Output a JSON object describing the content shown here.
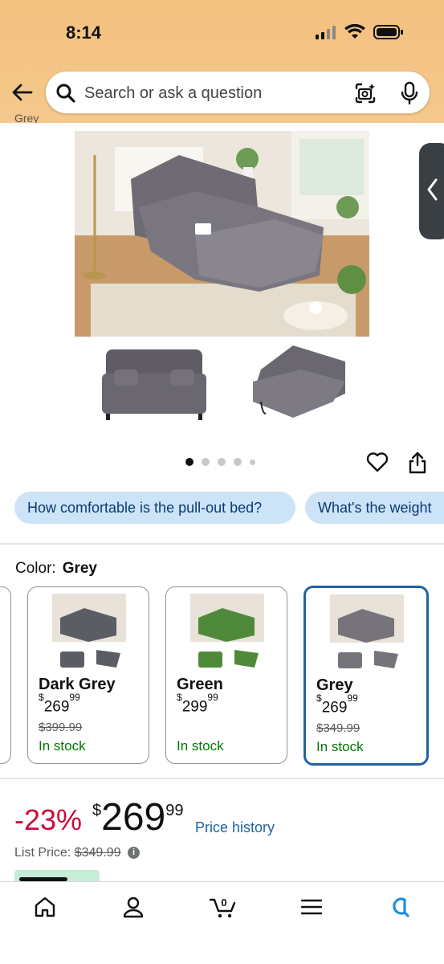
{
  "status_bar": {
    "time": "8:14"
  },
  "search": {
    "placeholder": "Search or ask a question"
  },
  "cut_text": "Grey",
  "carousel": {
    "dots": 5,
    "active": 0
  },
  "questions": [
    "How comfortable is the pull-out bed?",
    "What's the weight"
  ],
  "color": {
    "label": "Color:",
    "selected": "Grey"
  },
  "swatches": [
    {
      "name": "Dark Grey",
      "price_whole": "269",
      "price_cents": "99",
      "price_symbol": "$",
      "list_price": "$399.99",
      "stock": "In stock",
      "color": "#5a5d63"
    },
    {
      "name": "Green",
      "price_whole": "299",
      "price_cents": "99",
      "price_symbol": "$",
      "list_price": "",
      "stock": "In stock",
      "color": "#4f8a3b"
    },
    {
      "name": "Grey",
      "price_whole": "269",
      "price_cents": "99",
      "price_symbol": "$",
      "list_price": "$349.99",
      "stock": "In stock",
      "color": "#77737b"
    }
  ],
  "price": {
    "discount": "-23%",
    "symbol": "$",
    "whole": "269",
    "cents": "99",
    "history_link": "Price history",
    "list_label": "List Price:",
    "list_value": "$349.99"
  },
  "colors": {
    "header": "#f3c17f",
    "link": "#2162a1",
    "discount": "#cc0c39",
    "stock": "#007600",
    "pill_bg": "#cde3f7",
    "selected_border": "#2162a1"
  },
  "nav": {
    "cart_count": "0"
  }
}
